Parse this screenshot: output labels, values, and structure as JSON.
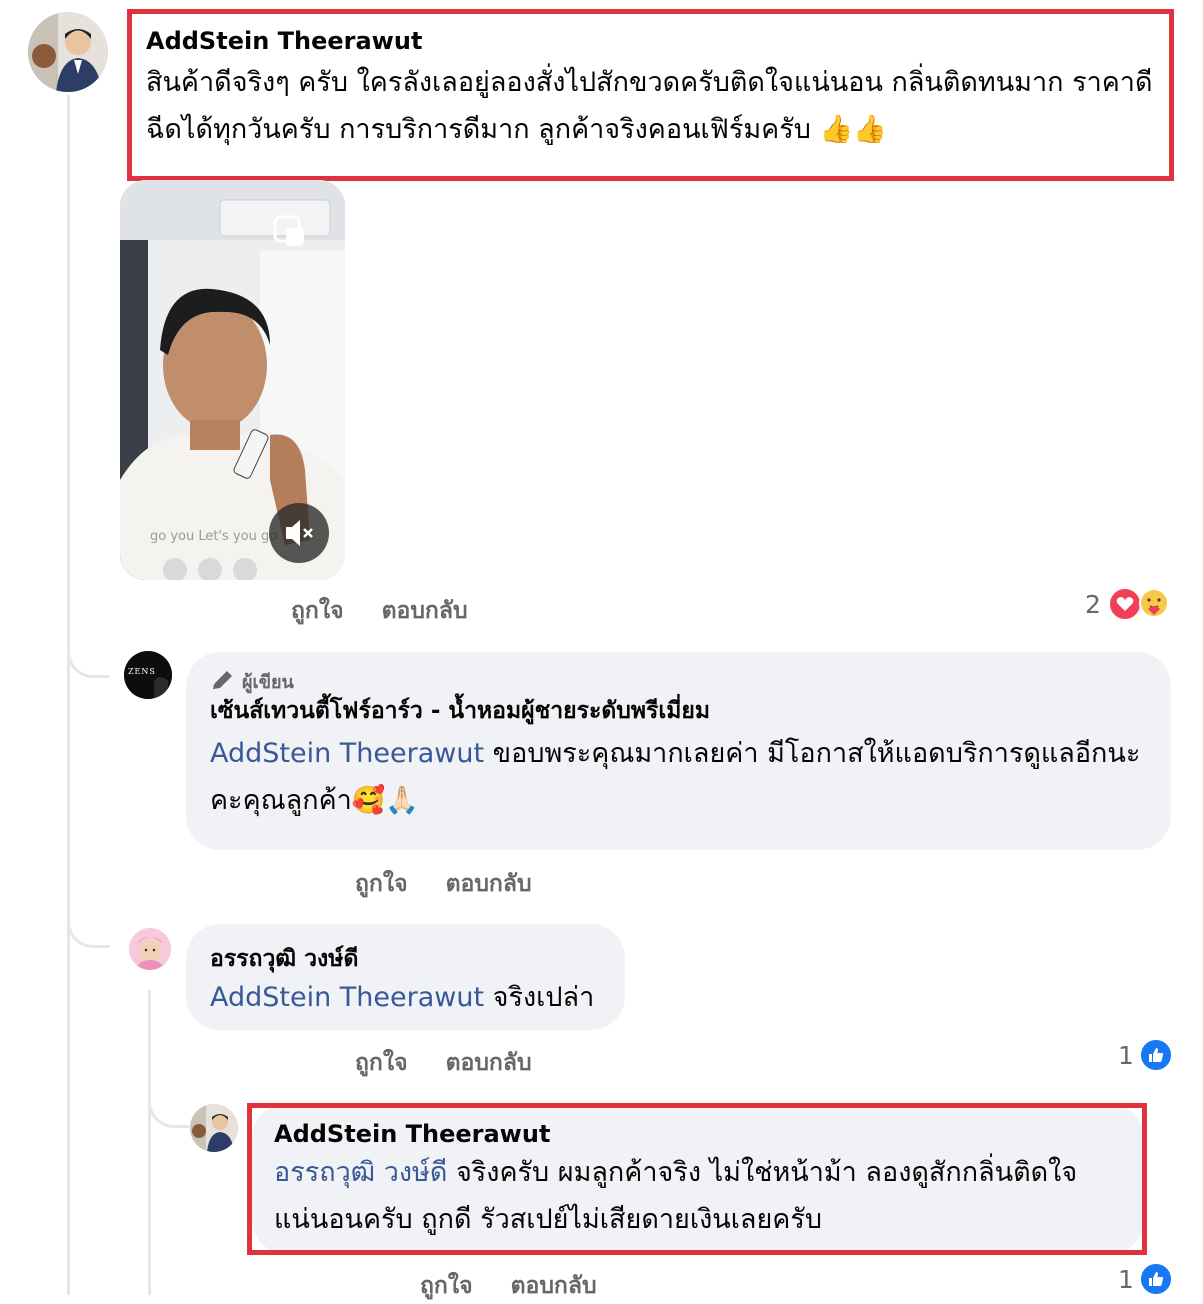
{
  "comments": [
    {
      "author": "AddStein Theerawut",
      "text": "สินค้าดีจริงๆ ครับ ใครลังเลอยู่ลองสั่งไปสักขวดครับติดใจแน่นอน กลิ่นติดทนมาก ราคาดีฉีดได้ทุกวันครับ การบริการดีมาก ลูกค้าจริงคอนเฟิร์มครับ 👍👍",
      "video": {
        "shirt_text": "go you Let's you go"
      },
      "like_label": "ถูกใจ",
      "reply_label": "ตอบกลับ",
      "reaction_count": "2",
      "colors": {
        "highlight": "#e0313f"
      }
    },
    {
      "author_badge": "ผู้เขียน",
      "avatar_text": "ZENS",
      "author": "เซ้นส์เทวนตี้โฟร์อาร์ว - น้ำหอมผู้ชายระดับพรีเมี่ยม",
      "mention": "AddStein Theerawut",
      "text": " ขอบพระคุณมากเลยค่า มีโอกาสให้แอดบริการดูแลอีกนะคะคุณลูกค้า🥰🙏🏻",
      "like_label": "ถูกใจ",
      "reply_label": "ตอบกลับ"
    },
    {
      "author": "อรรถวุฒิ วงษ์ดี",
      "mention": "AddStein Theerawut",
      "text": " จริงเปล่า",
      "like_label": "ถูกใจ",
      "reply_label": "ตอบกลับ",
      "reaction_count": "1"
    },
    {
      "author": "AddStein Theerawut",
      "mention": "อรรถวุฒิ วงษ์ดี",
      "text": " จริงครับ ผมลูกค้าจริง ไม่ใช่หน้าม้า ลองดูสักกลิ่นติดใจแน่นอนครับ ถูกดี รัวสเปย์ไม่เสียดายเงินเลยครับ",
      "like_label": "ถูกใจ",
      "reply_label": "ตอบกลับ",
      "reaction_count": "1"
    }
  ],
  "colors": {
    "accent": "#1877f2",
    "mention": "#385898",
    "bubble": "#f0f2f5",
    "highlight": "#e0313f"
  }
}
